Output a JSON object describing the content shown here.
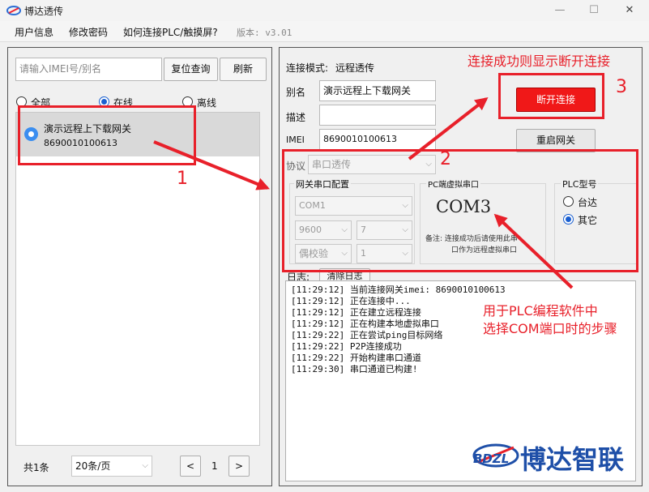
{
  "window": {
    "title": "博达透传",
    "minimize": "—",
    "maximize": "☐",
    "close": "✕"
  },
  "menu": {
    "user_info": "用户信息",
    "change_password": "修改密码",
    "how_connect": "如何连接PLC/触摸屏?",
    "version": "版本: v3.01"
  },
  "left": {
    "search_placeholder": "请输入IMEI号/别名",
    "reset_button": "复位查询",
    "refresh_button": "刷新",
    "filters": [
      {
        "label": "全部",
        "checked": false
      },
      {
        "label": "在线",
        "checked": true
      },
      {
        "label": "离线",
        "checked": false
      }
    ],
    "devices": [
      {
        "name": "演示远程上下载网关",
        "imei": "8690010100613",
        "selected": true
      }
    ],
    "pagination": {
      "total": "共1条",
      "page_size": "20条/页",
      "prev": "<",
      "page": "1",
      "next": ">"
    }
  },
  "right": {
    "mode_label": "连接模式:",
    "mode_value": "远程透传",
    "alias_label": "别名",
    "alias_value": "演示远程上下载网关",
    "desc_label": "描述",
    "desc_value": "",
    "imei_label": "IMEI",
    "imei_value": "8690010100613",
    "disconnect_button": "断开连接",
    "restart_button": "重启网关",
    "protocol_label": "协议",
    "protocol_value": "串口透传",
    "serial_group": {
      "title": "网关串口配置",
      "port": "COM1",
      "baud": "9600",
      "data_bits": "7",
      "parity": "偶校验",
      "stop_bits": "1"
    },
    "vport_group": {
      "title": "PC端虚拟串口",
      "port": "COM3",
      "note_line1": "备注: 连接成功后请使用此串",
      "note_line2": "口作为远程虚拟串口"
    },
    "plc_group": {
      "title": "PLC型号",
      "options": [
        {
          "label": "台达",
          "checked": false
        },
        {
          "label": "其它",
          "checked": true
        }
      ]
    },
    "log_label": "日志:",
    "clear_log_button": "清除日志",
    "log_lines": [
      "[11:29:12] 当前连接网关imei: 8690010100613",
      "[11:29:12] 正在连接中...",
      "[11:29:12] 正在建立远程连接",
      "[11:29:12] 正在构建本地虚拟串口",
      "[11:29:22] 正在尝试ping目标网络",
      "[11:29:22] P2P连接成功",
      "[11:29:22] 开始构建串口通道",
      "[11:29:30] 串口通道已构建!"
    ]
  },
  "annotations": {
    "num1": "1",
    "num2": "2",
    "num3": "3",
    "callout_top": "连接成功则显示断开连接",
    "callout_bottom_line1": "用于PLC编程软件中",
    "callout_bottom_line2": "选择COM端口时的步骤"
  },
  "watermark": {
    "logo_text": "BDZL",
    "brand": "博达智联"
  },
  "colors": {
    "annotation_red": "#e8202a",
    "disconnect_red": "#f01818",
    "selected_blue": "#1a5fd0",
    "brand_blue": "#1e4fa8"
  }
}
